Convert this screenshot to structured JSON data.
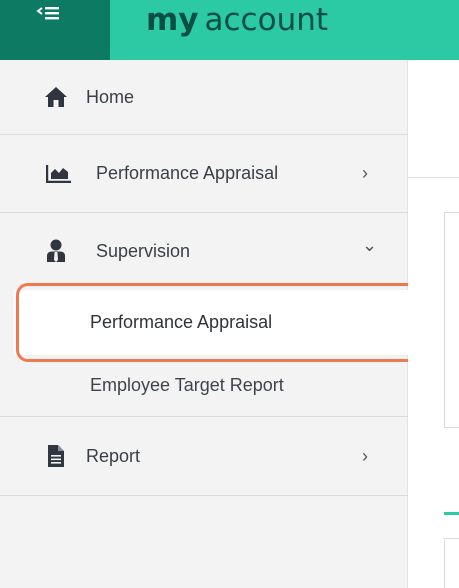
{
  "header": {
    "brand_bold": "my",
    "brand_light": "account"
  },
  "sidebar": {
    "items": [
      {
        "label": "Home",
        "icon": "home-icon"
      },
      {
        "label": "Performance Appraisal",
        "icon": "area-chart-icon",
        "chevron": "›"
      },
      {
        "label": "Supervision",
        "icon": "supervisor-icon",
        "chevron": "⌄",
        "expanded": true,
        "children": [
          {
            "label": "Performance Appraisal",
            "active": true
          },
          {
            "label": "Employee Target Report"
          }
        ]
      },
      {
        "label": "Report",
        "icon": "document-icon",
        "chevron": "›"
      }
    ]
  },
  "colors": {
    "header_dark": "#0d7a63",
    "header_accent": "#2cc9a5",
    "highlight_border": "#ef7a52",
    "sidebar_bg": "#f3f3f4"
  }
}
